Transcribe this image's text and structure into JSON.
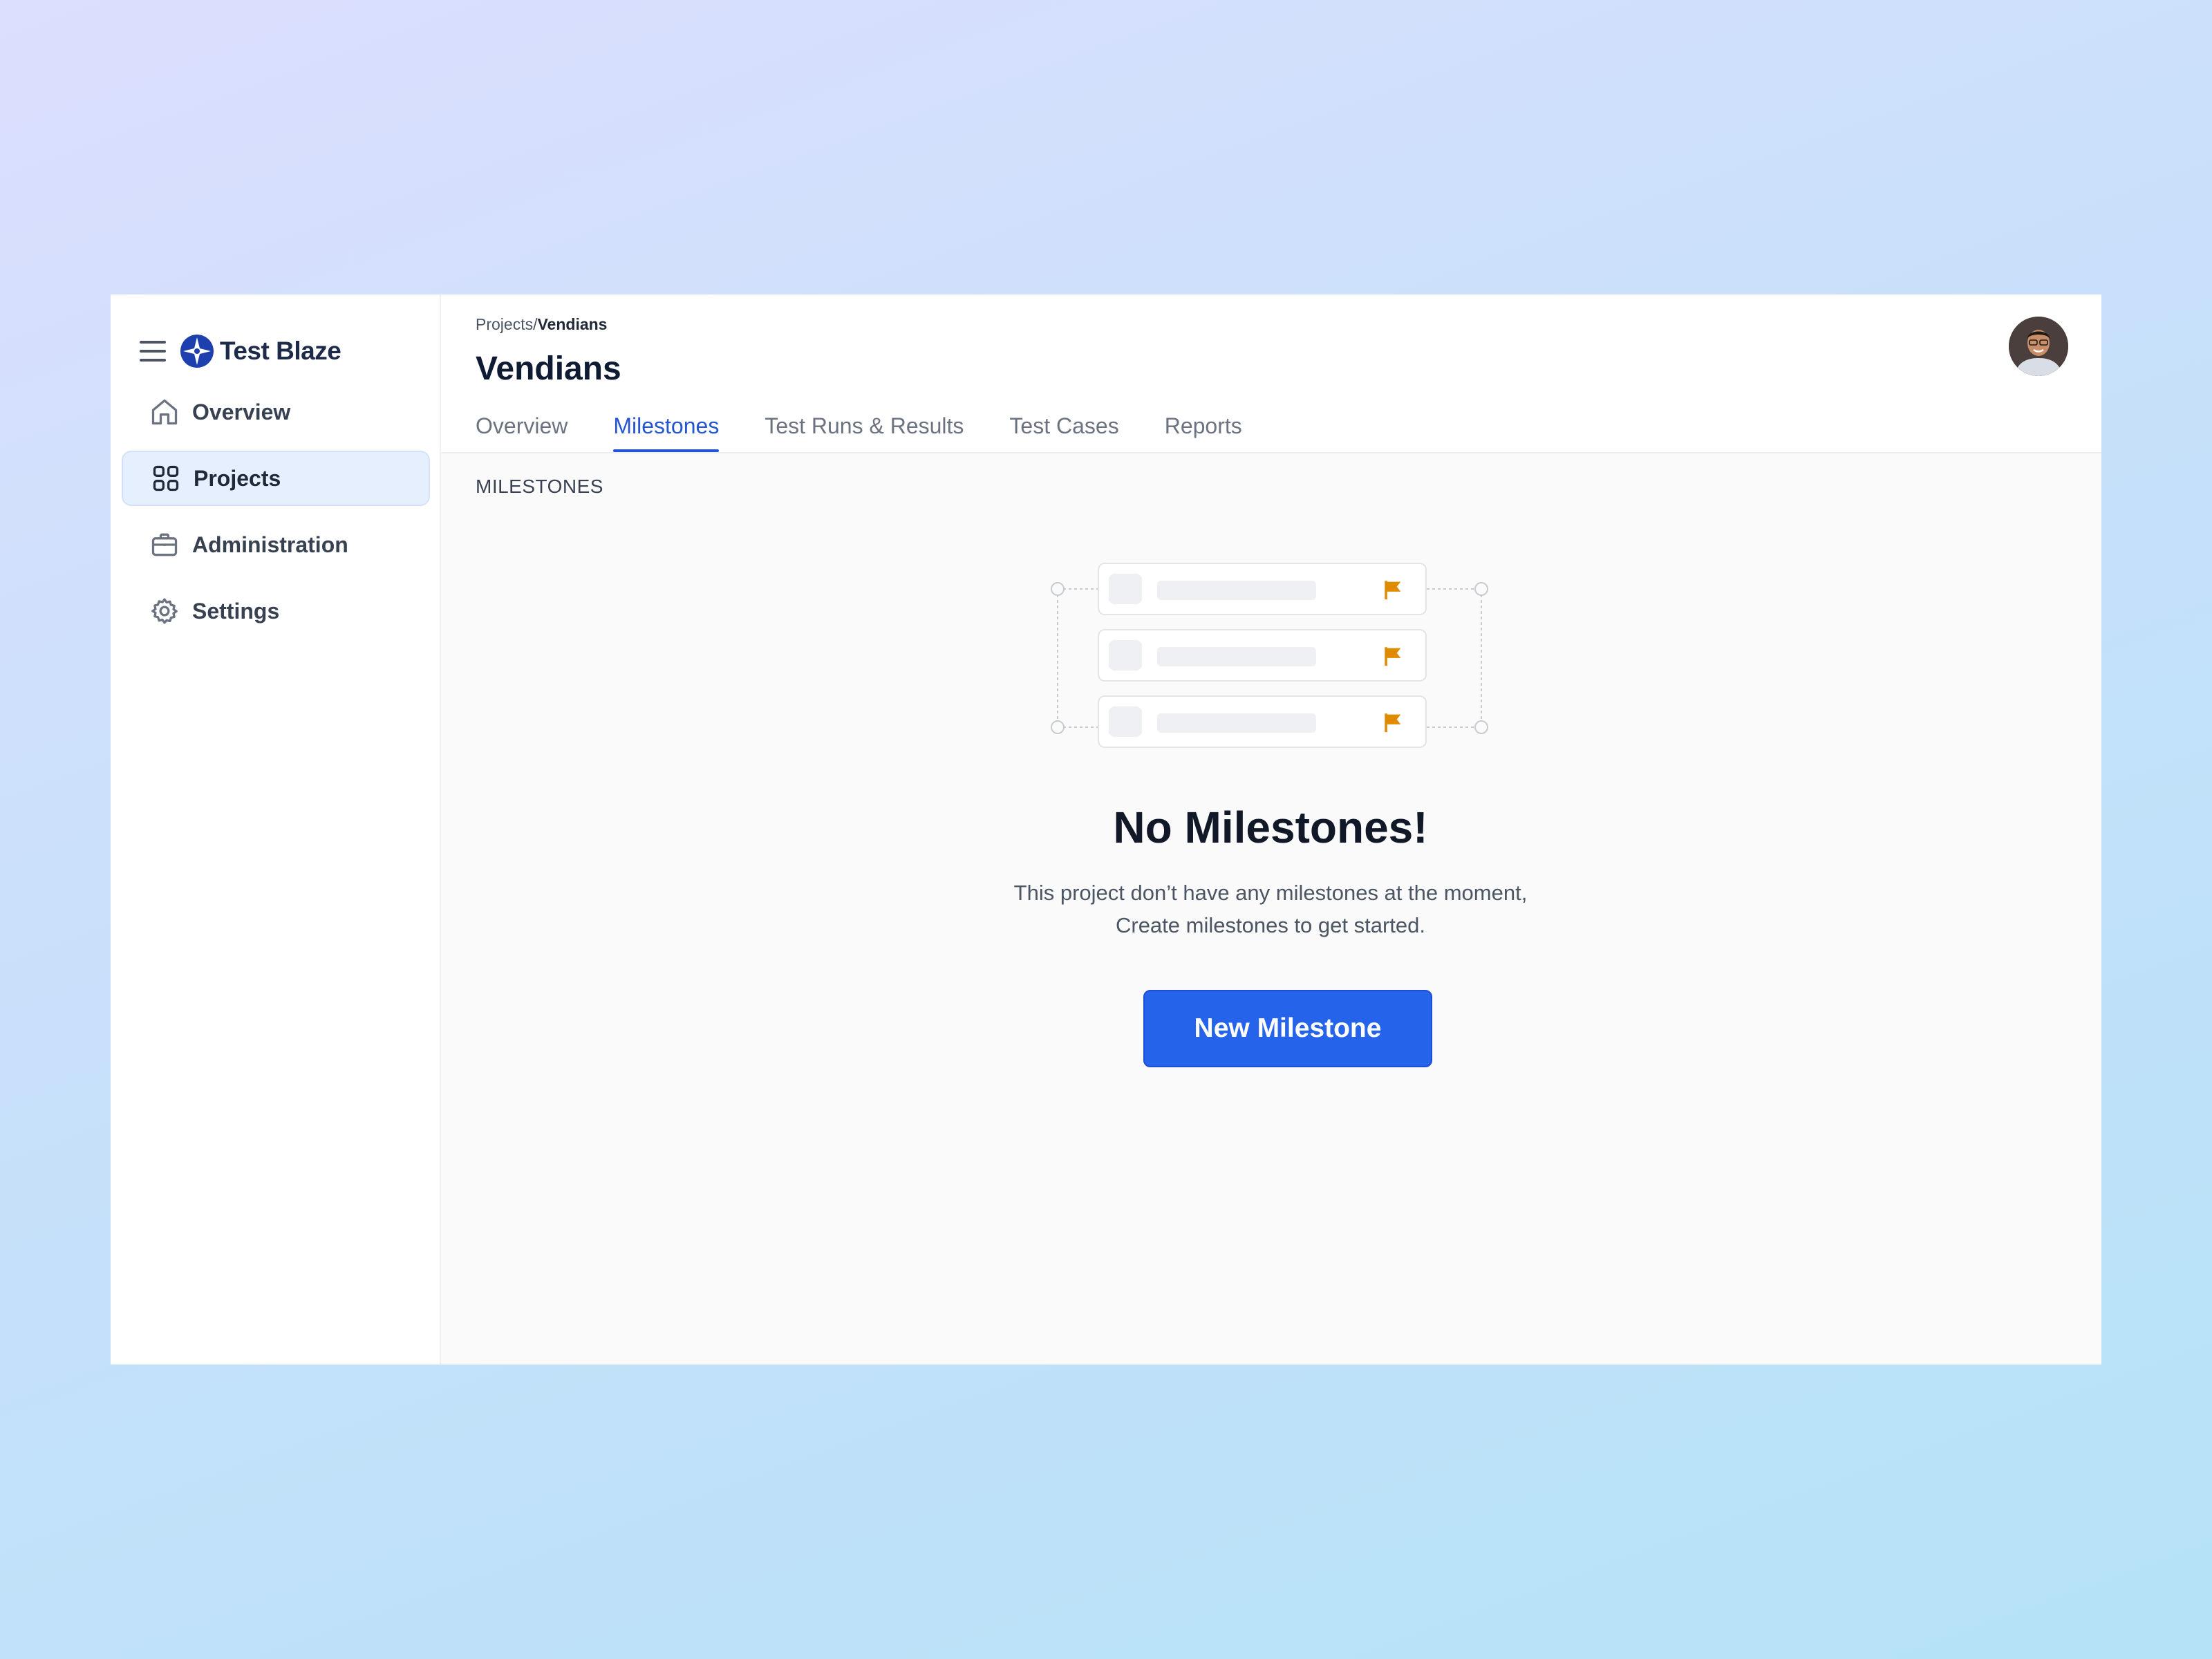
{
  "brand": {
    "name": "Test Blaze",
    "accent": "#1e40af"
  },
  "sidebar": {
    "items": [
      {
        "label": "Overview",
        "icon": "home-icon",
        "active": false
      },
      {
        "label": "Projects",
        "icon": "grid-icon",
        "active": true
      },
      {
        "label": "Administration",
        "icon": "briefcase-icon",
        "active": false
      },
      {
        "label": "Settings",
        "icon": "gear-icon",
        "active": false
      }
    ]
  },
  "header": {
    "breadcrumb": {
      "parent": "Projects",
      "separator": "/",
      "current": "Vendians"
    },
    "title": "Vendians",
    "tabs": [
      {
        "label": "Overview",
        "active": false
      },
      {
        "label": "Milestones",
        "active": true
      },
      {
        "label": "Test Runs & Results",
        "active": false
      },
      {
        "label": "Test Cases",
        "active": false
      },
      {
        "label": "Reports",
        "active": false
      }
    ]
  },
  "main": {
    "section_label": "MILESTONES",
    "empty_state": {
      "title": "No Milestones!",
      "description_line1": "This project don’t have any milestones at the moment,",
      "description_line2": "Create milestones to get started.",
      "button_label": "New Milestone",
      "flag_color": "#e08a00"
    }
  },
  "colors": {
    "primary": "#2563eb",
    "active_tab": "#2456d4"
  }
}
